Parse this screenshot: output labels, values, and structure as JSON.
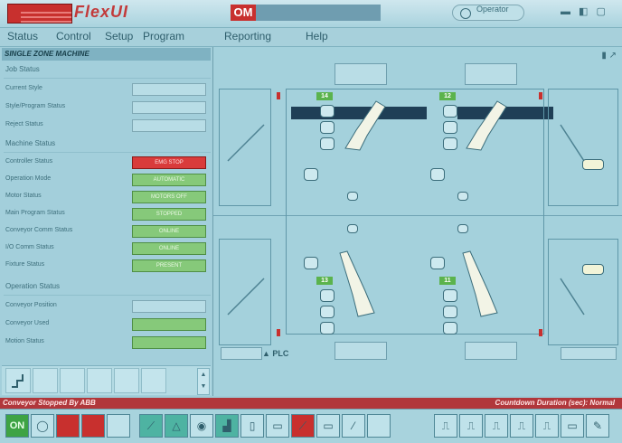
{
  "titlebar": {
    "app_name": "FlexUI",
    "mode": "OM",
    "operator_label": "Operator"
  },
  "menu": [
    "Status",
    "Control",
    "Setup",
    "Program",
    "Reporting",
    "Help"
  ],
  "left_panel": {
    "title": "SINGLE ZONE MACHINE",
    "groups": [
      {
        "title": "Job Status",
        "rows": [
          {
            "label": "Current Style",
            "value": ""
          },
          {
            "label": "Style/Program Status",
            "value": ""
          },
          {
            "label": "Reject Status",
            "value": ""
          }
        ]
      },
      {
        "title": "Machine Status",
        "rows": [
          {
            "label": "Controller Status",
            "value": "EMG STOP",
            "tone": "red"
          },
          {
            "label": "Operation Mode",
            "value": "AUTOMATIC",
            "tone": "green"
          },
          {
            "label": "Motor Status",
            "value": "MOTORS OFF",
            "tone": "green"
          },
          {
            "label": "Main Program Status",
            "value": "STOPPED",
            "tone": "green"
          },
          {
            "label": "Conveyor Comm Status",
            "value": "ONLINE",
            "tone": "green"
          },
          {
            "label": "I/O Comm Status",
            "value": "ONLINE",
            "tone": "green"
          },
          {
            "label": "Fixture Status",
            "value": "PRESENT",
            "tone": "green"
          }
        ]
      },
      {
        "title": "Operation Status",
        "rows": [
          {
            "label": "Conveyor Position",
            "value": ""
          },
          {
            "label": "Conveyor Used",
            "value": "",
            "tone": "green"
          },
          {
            "label": "Motion Status",
            "value": "",
            "tone": "green"
          }
        ]
      }
    ]
  },
  "stage": {
    "plc_label": "PLC",
    "robot_tags": [
      "14",
      "12",
      "13",
      "11"
    ]
  },
  "status": {
    "left": "Conveyor Stopped By ABB",
    "right": "Countdown Duration (sec): Normal"
  },
  "toolbar": {
    "first_label": "ON"
  },
  "colors": {
    "accent_red": "#c8302e",
    "ok_green": "#86c97a",
    "bg": "#9fcbd6"
  }
}
